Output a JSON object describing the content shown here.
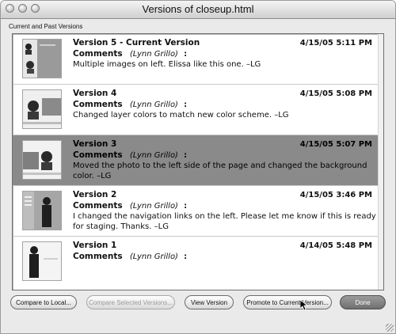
{
  "window": {
    "title": "Versions of closeup.html"
  },
  "section_label": "Current and Past Versions",
  "versions": [
    {
      "label": "Version 5 - Current Version",
      "date": "4/15/05 5:11 PM",
      "comments_key": "Comments",
      "author": "(Lynn Grillo)",
      "colon": ":",
      "comment": "Multiple images on left. Elissa like this one. –LG",
      "selected": false
    },
    {
      "label": "Version 4",
      "date": "4/15/05 5:08 PM",
      "comments_key": "Comments",
      "author": "(Lynn Grillo)",
      "colon": ":",
      "comment": "Changed layer colors to match new color scheme. –LG",
      "selected": false
    },
    {
      "label": "Version 3",
      "date": "4/15/05 5:07 PM",
      "comments_key": "Comments",
      "author": "(Lynn Grillo)",
      "colon": ":",
      "comment": "Moved the photo to the left side of the page and changed the background color. –LG",
      "selected": true
    },
    {
      "label": "Version 2",
      "date": "4/15/05 3:46 PM",
      "comments_key": "Comments",
      "author": "(Lynn Grillo)",
      "colon": ":",
      "comment": "I changed the navigation links on the left. Please let me know if this is ready for staging. Thanks. –LG",
      "selected": false
    },
    {
      "label": "Version 1",
      "date": "4/14/05 5:48 PM",
      "comments_key": "Comments",
      "author": "(Lynn Grillo)",
      "colon": ":",
      "comment": "",
      "selected": false
    }
  ],
  "buttons": {
    "compare_local": "Compare to Local...",
    "compare_selected": "Compare Selected Versions...",
    "view_version": "View Version",
    "promote": "Promote to Current Version...",
    "done": "Done"
  },
  "colors": {
    "selected_row": "#8a8a8a",
    "window_bg": "#eaeaea"
  }
}
